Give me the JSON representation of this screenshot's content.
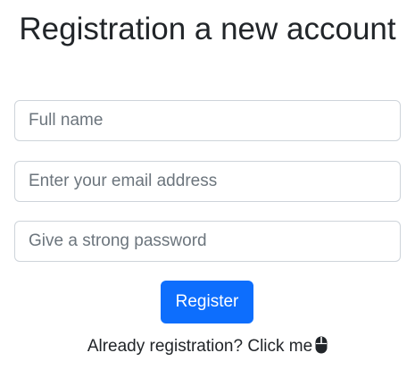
{
  "page": {
    "title": "Registration a new account"
  },
  "form": {
    "full_name": {
      "value": "",
      "placeholder": "Full name"
    },
    "email": {
      "value": "",
      "placeholder": "Enter your email address"
    },
    "password": {
      "value": "",
      "placeholder": "Give a strong password"
    },
    "submit_label": "Register"
  },
  "login_prompt": {
    "text": "Already registration? Click me",
    "icon": "mouse-icon"
  },
  "colors": {
    "primary": "#0d6efd",
    "text": "#212529",
    "placeholder": "#6c757d",
    "border": "#ced4da"
  }
}
